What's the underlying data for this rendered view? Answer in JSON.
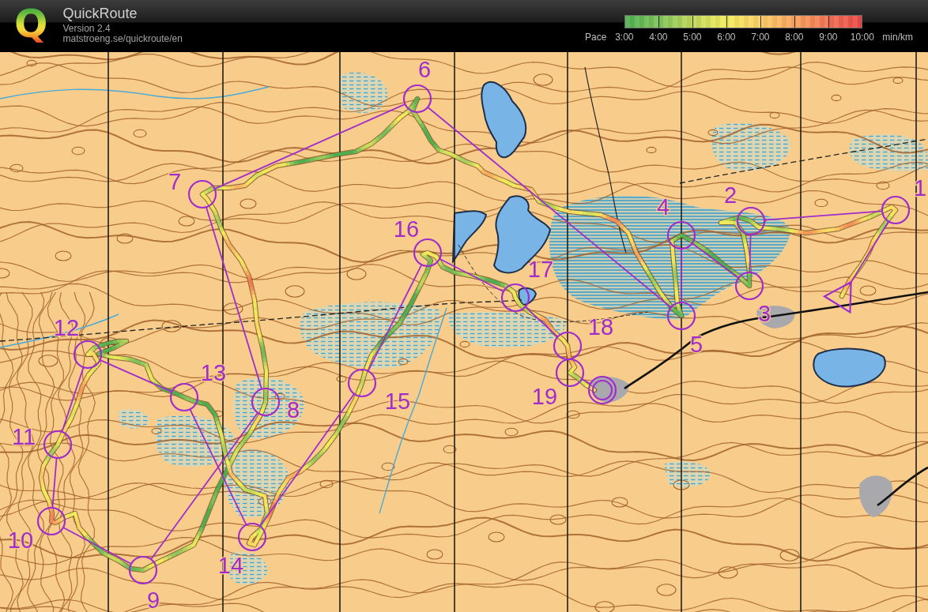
{
  "header": {
    "logo": "Q",
    "title": "QuickRoute",
    "version": "Version 2.4",
    "url": "matstroeng.se/quickroute/en"
  },
  "pace_scale": {
    "label": "Pace",
    "ticks": [
      "3:00",
      "4:00",
      "5:00",
      "6:00",
      "7:00",
      "8:00",
      "9:00",
      "10:00"
    ],
    "unit": "min/km"
  },
  "course": {
    "controls": [
      {
        "kind": "start"
      },
      {
        "kind": "control",
        "number": "1"
      },
      {
        "kind": "control",
        "number": "2"
      },
      {
        "kind": "control",
        "number": "3"
      },
      {
        "kind": "control",
        "number": "4"
      },
      {
        "kind": "control",
        "number": "5"
      },
      {
        "kind": "control",
        "number": "6"
      },
      {
        "kind": "control",
        "number": "7"
      },
      {
        "kind": "control",
        "number": "8"
      },
      {
        "kind": "control",
        "number": "9"
      },
      {
        "kind": "control",
        "number": "10"
      },
      {
        "kind": "control",
        "number": "11"
      },
      {
        "kind": "control",
        "number": "12"
      },
      {
        "kind": "control",
        "number": "13"
      },
      {
        "kind": "control",
        "number": "14"
      },
      {
        "kind": "control",
        "number": "15"
      },
      {
        "kind": "control",
        "number": "16"
      },
      {
        "kind": "control",
        "number": "17"
      },
      {
        "kind": "control",
        "number": "18"
      },
      {
        "kind": "control",
        "number": "19"
      },
      {
        "kind": "finish"
      }
    ]
  }
}
